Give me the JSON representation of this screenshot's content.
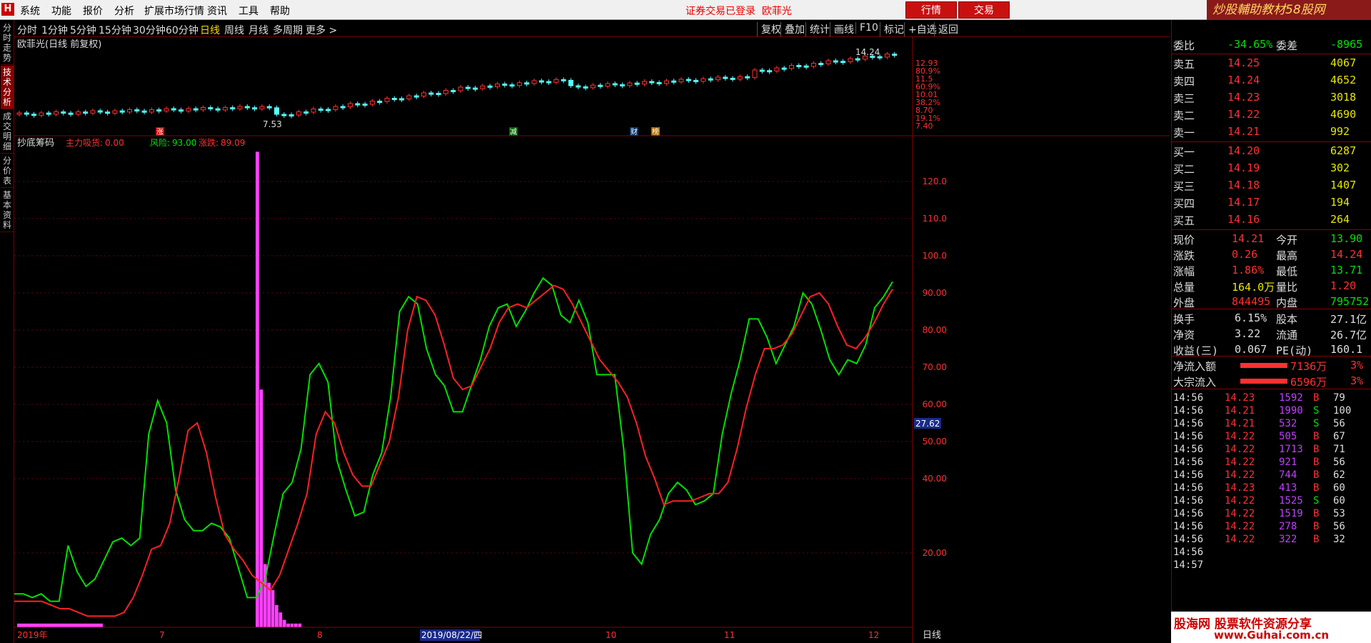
{
  "menu": {
    "logo": "H",
    "items": [
      "系统",
      "功能",
      "报价",
      "分析",
      "扩展市场行情",
      "资讯",
      "工具",
      "帮助"
    ],
    "login_status": "证券交易已登录",
    "stock_name": "欧菲光",
    "trade_buttons": [
      "行情",
      "交易"
    ],
    "brand": "炒股輔助教材58股网"
  },
  "left_tabs": [
    "分时走势",
    "技术分析",
    "成交明细",
    "分价表",
    "基本资料"
  ],
  "period_tabs": [
    "分时",
    "1分钟",
    "5分钟",
    "15分钟",
    "30分钟",
    "60分钟",
    "日线",
    "周线",
    "月线",
    "多周期",
    "更多 >"
  ],
  "active_period": "日线",
  "tool_buttons": [
    "复权",
    "叠加",
    "统计",
    "画线",
    "F10",
    "标记",
    "+自选",
    "返回"
  ],
  "kline": {
    "title": "欧菲光(日线 前复权)",
    "price_scale": [
      "12.93",
      "80.9%",
      "11.5",
      "60.9%",
      "10.01",
      "38.2%",
      "8.70",
      "19.1%",
      "7.40"
    ],
    "high_label": "14.24",
    "low_label": "7.53",
    "markers": [
      "涨",
      "减",
      "财",
      "榜"
    ]
  },
  "indicator": {
    "name": "抄底筹码",
    "main_label": "主力吸货:",
    "main_value": "0.00",
    "risk_label": "风险:",
    "risk_value": "93.00",
    "rise_label": "涨跌:",
    "rise_value": "89.09",
    "y_ticks": [
      "120.0",
      "110.0",
      "100.0",
      "90.00",
      "80.00",
      "70.00",
      "60.00",
      "50.00",
      "40.00",
      "20.00"
    ],
    "current_value": "27.62",
    "time_labels": [
      "2019年",
      "7",
      "8",
      "2019/08/22/四",
      "10",
      "11",
      "12"
    ],
    "period_label": "日线"
  },
  "chart_data": {
    "type": "line",
    "series": [
      {
        "name": "风险",
        "values": [
          9,
          9,
          8,
          9,
          7,
          7,
          22,
          15,
          11,
          13,
          18,
          23,
          24,
          22,
          24,
          52,
          61,
          55,
          37,
          29,
          26,
          26,
          28,
          27,
          24,
          16,
          8,
          8,
          13,
          25,
          36,
          39,
          48,
          68,
          71,
          66,
          45,
          37,
          30,
          31,
          41,
          47,
          62,
          85,
          89,
          87,
          75,
          68,
          65,
          58,
          58,
          65,
          72,
          81,
          86,
          87,
          81,
          85,
          90,
          94,
          92,
          84,
          82,
          88,
          82,
          68,
          68,
          68,
          48,
          20,
          17,
          25,
          29,
          36,
          39,
          37,
          33,
          34,
          36,
          52,
          63,
          72,
          83,
          83,
          78,
          71,
          76,
          81,
          90,
          87,
          80,
          72,
          68,
          72,
          71,
          76,
          86,
          89,
          93
        ]
      },
      {
        "name": "涨跌",
        "values": [
          7,
          7,
          7,
          7,
          6,
          5,
          5,
          4,
          3,
          3,
          3,
          3,
          4,
          8,
          14,
          21,
          22,
          28,
          40,
          53,
          55,
          47,
          35,
          25,
          21,
          18,
          14,
          12,
          10,
          14,
          21,
          28,
          36,
          52,
          58,
          55,
          47,
          41,
          38,
          38,
          44,
          50,
          62,
          80,
          89,
          88,
          84,
          76,
          67,
          64,
          65,
          70,
          75,
          82,
          86,
          87,
          86,
          88,
          90,
          92,
          91,
          87,
          82,
          77,
          72,
          69,
          66,
          62,
          55,
          46,
          40,
          33,
          34,
          34,
          34,
          35,
          36,
          36,
          39,
          48,
          59,
          68,
          75,
          75,
          76,
          79,
          84,
          89,
          90,
          87,
          81,
          76,
          75,
          78,
          82,
          87,
          91
        ]
      }
    ],
    "bars": [
      1,
      0,
      0,
      0,
      0,
      0,
      0,
      0,
      0,
      0,
      0,
      0,
      0,
      0,
      0,
      0,
      0,
      0,
      0,
      0,
      0,
      0,
      0,
      0,
      0,
      0,
      128,
      64,
      17,
      12,
      10,
      6,
      4,
      2,
      1,
      1,
      1,
      1
    ],
    "ylim": [
      0,
      130
    ]
  },
  "quotes": {
    "wei_bi_label": "委比",
    "wei_bi": "-34.65%",
    "wei_cha_label": "委差",
    "wei_cha": "-8965",
    "sells": [
      {
        "label": "卖五",
        "price": "14.25",
        "vol": "4067"
      },
      {
        "label": "卖四",
        "price": "14.24",
        "vol": "4652"
      },
      {
        "label": "卖三",
        "price": "14.23",
        "vol": "3018"
      },
      {
        "label": "卖二",
        "price": "14.22",
        "vol": "4690"
      },
      {
        "label": "卖一",
        "price": "14.21",
        "vol": "992"
      }
    ],
    "buys": [
      {
        "label": "买一",
        "price": "14.20",
        "vol": "6287"
      },
      {
        "label": "买二",
        "price": "14.19",
        "vol": "302"
      },
      {
        "label": "买三",
        "price": "14.18",
        "vol": "1407"
      },
      {
        "label": "买四",
        "price": "14.17",
        "vol": "194"
      },
      {
        "label": "买五",
        "price": "14.16",
        "vol": "264"
      }
    ],
    "stats": [
      {
        "l1": "现价",
        "v1": "14.21",
        "l2": "今开",
        "v2": "13.90"
      },
      {
        "l1": "涨跌",
        "v1": "0.26",
        "l2": "最高",
        "v2": "14.24"
      },
      {
        "l1": "涨幅",
        "v1": "1.86%",
        "l2": "最低",
        "v2": "13.71"
      },
      {
        "l1": "总量",
        "v1": "164.0万",
        "l2": "量比",
        "v2": "1.20"
      },
      {
        "l1": "外盘",
        "v1": "844495",
        "l2": "内盘",
        "v2": "795752"
      }
    ],
    "stats2": [
      {
        "l1": "换手",
        "v1": "6.15%",
        "l2": "股本",
        "v2": "27.1亿"
      },
      {
        "l1": "净资",
        "v1": "3.22",
        "l2": "流通",
        "v2": "26.7亿"
      },
      {
        "l1": "收益(三)",
        "v1": "0.067",
        "l2": "PE(动)",
        "v2": "160.1"
      }
    ],
    "flows": [
      {
        "label": "净流入额",
        "value": "7136万",
        "pct": "3%"
      },
      {
        "label": "大宗流入",
        "value": "6596万",
        "pct": "3%"
      }
    ]
  },
  "ticks": [
    {
      "t": "14:56",
      "p": "14.23",
      "v": "1592",
      "d": "B",
      "n": "79"
    },
    {
      "t": "14:56",
      "p": "14.21",
      "v": "1990",
      "d": "S",
      "n": "100"
    },
    {
      "t": "14:56",
      "p": "14.21",
      "v": "532",
      "d": "S",
      "n": "56"
    },
    {
      "t": "14:56",
      "p": "14.22",
      "v": "505",
      "d": "B",
      "n": "67"
    },
    {
      "t": "14:56",
      "p": "14.22",
      "v": "1713",
      "d": "B",
      "n": "71"
    },
    {
      "t": "14:56",
      "p": "14.22",
      "v": "921",
      "d": "B",
      "n": "56"
    },
    {
      "t": "14:56",
      "p": "14.22",
      "v": "744",
      "d": "B",
      "n": "62"
    },
    {
      "t": "14:56",
      "p": "14.23",
      "v": "413",
      "d": "B",
      "n": "60"
    },
    {
      "t": "14:56",
      "p": "14.22",
      "v": "1525",
      "d": "S",
      "n": "60"
    },
    {
      "t": "14:56",
      "p": "14.22",
      "v": "1519",
      "d": "B",
      "n": "53"
    },
    {
      "t": "14:56",
      "p": "14.22",
      "v": "278",
      "d": "B",
      "n": "56"
    },
    {
      "t": "14:56",
      "p": "14.22",
      "v": "322",
      "d": "B",
      "n": "32"
    },
    {
      "t": "14:56",
      "p": "",
      "v": "",
      "d": "",
      "n": ""
    },
    {
      "t": "14:57",
      "p": "",
      "v": "",
      "d": "",
      "n": ""
    }
  ],
  "ad": {
    "line1": "股海网 股票软件资源分享",
    "line2": "www.Guhai.com.cn"
  },
  "colors": {
    "up": "#ff3030",
    "down": "#54ffff",
    "green": "#00e000",
    "yellow": "#e6e600",
    "magenta": "#ff40ff",
    "border": "#800000"
  }
}
